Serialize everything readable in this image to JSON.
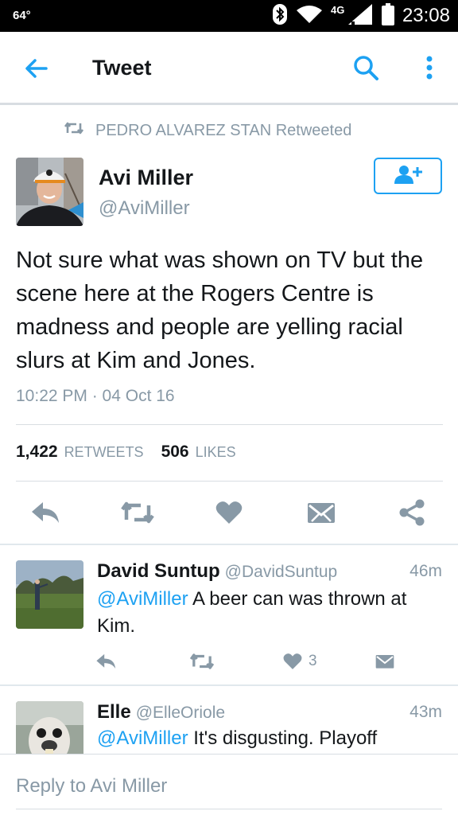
{
  "status_bar": {
    "temperature": "64°",
    "network": "4G LTE",
    "clock": "23:08"
  },
  "app_bar": {
    "title": "Tweet"
  },
  "retweet_context": {
    "text": "PEDRO ALVAREZ STAN Retweeted"
  },
  "tweet": {
    "author_name": "Avi Miller",
    "author_handle": "@AviMiller",
    "text": "Not sure what was shown on TV but the scene here at the Rogers Centre is madness and people are yelling racial slurs at Kim and Jones.",
    "timestamp": "10:22 PM · 04 Oct 16",
    "retweets_count": "1,422",
    "retweets_label": "RETWEETS",
    "likes_count": "506",
    "likes_label": "LIKES"
  },
  "replies": [
    {
      "name": "David Suntup",
      "handle": "@DavidSuntup",
      "time": "46m",
      "mention": "@AviMiller",
      "text": " A beer can was thrown at Kim.",
      "like_count": "3"
    },
    {
      "name": "Elle",
      "handle": "@ElleOriole",
      "time": "43m",
      "mention": "@AviMiller",
      "text": " It's disgusting. Playoff"
    }
  ],
  "composer": {
    "placeholder": "Reply to Avi Miller"
  },
  "colors": {
    "accent": "#1da1f2",
    "muted": "#8899a6",
    "icon_gray": "#8899a6",
    "text": "#14171a"
  }
}
